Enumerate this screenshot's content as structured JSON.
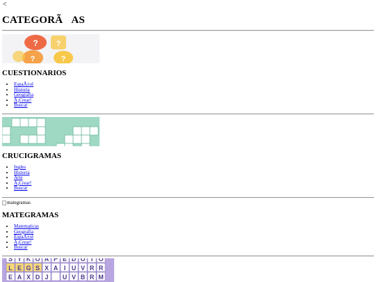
{
  "nav": {
    "back_label": "<"
  },
  "page": {
    "title": "CATEGORÃAS"
  },
  "sections": [
    {
      "title": "CUESTIONARIOS",
      "image_name": "quiz-banner-image",
      "links": [
        "EspaÃ±ol",
        "Historia",
        "Geografia",
        "Â¡Crear!",
        "Buscar"
      ]
    },
    {
      "title": "CRUCIGRAMAS",
      "image_name": "crossword-banner-image",
      "links": [
        "Ingles",
        "Historia",
        "Arte",
        "Â¡Crear!",
        "Buscar"
      ]
    },
    {
      "title": "MATEGRAMAS",
      "image_alt": "mategramas",
      "links": [
        "Matematicas",
        "Geografia",
        "EspaÃ±ol",
        "Â¡Crear!",
        "Buscar"
      ]
    },
    {
      "image_name": "wordsearch-banner-image",
      "wordsearch_rows": [
        "SYKOAPEDOTO",
        "LEGSXAIUVRR",
        "EAXDJ UVBRM"
      ]
    }
  ],
  "colors": {
    "link": "#0000ee",
    "quiz_bg": "#f3f3f6",
    "quiz_orange": "#f5a24a",
    "quiz_red": "#ee6b45",
    "quiz_yellow": "#f7c84a",
    "crossword_bg": "#9fd8c3",
    "wordsearch_bg": "#b8a6e0",
    "wordsearch_cell": "#f6d978"
  }
}
